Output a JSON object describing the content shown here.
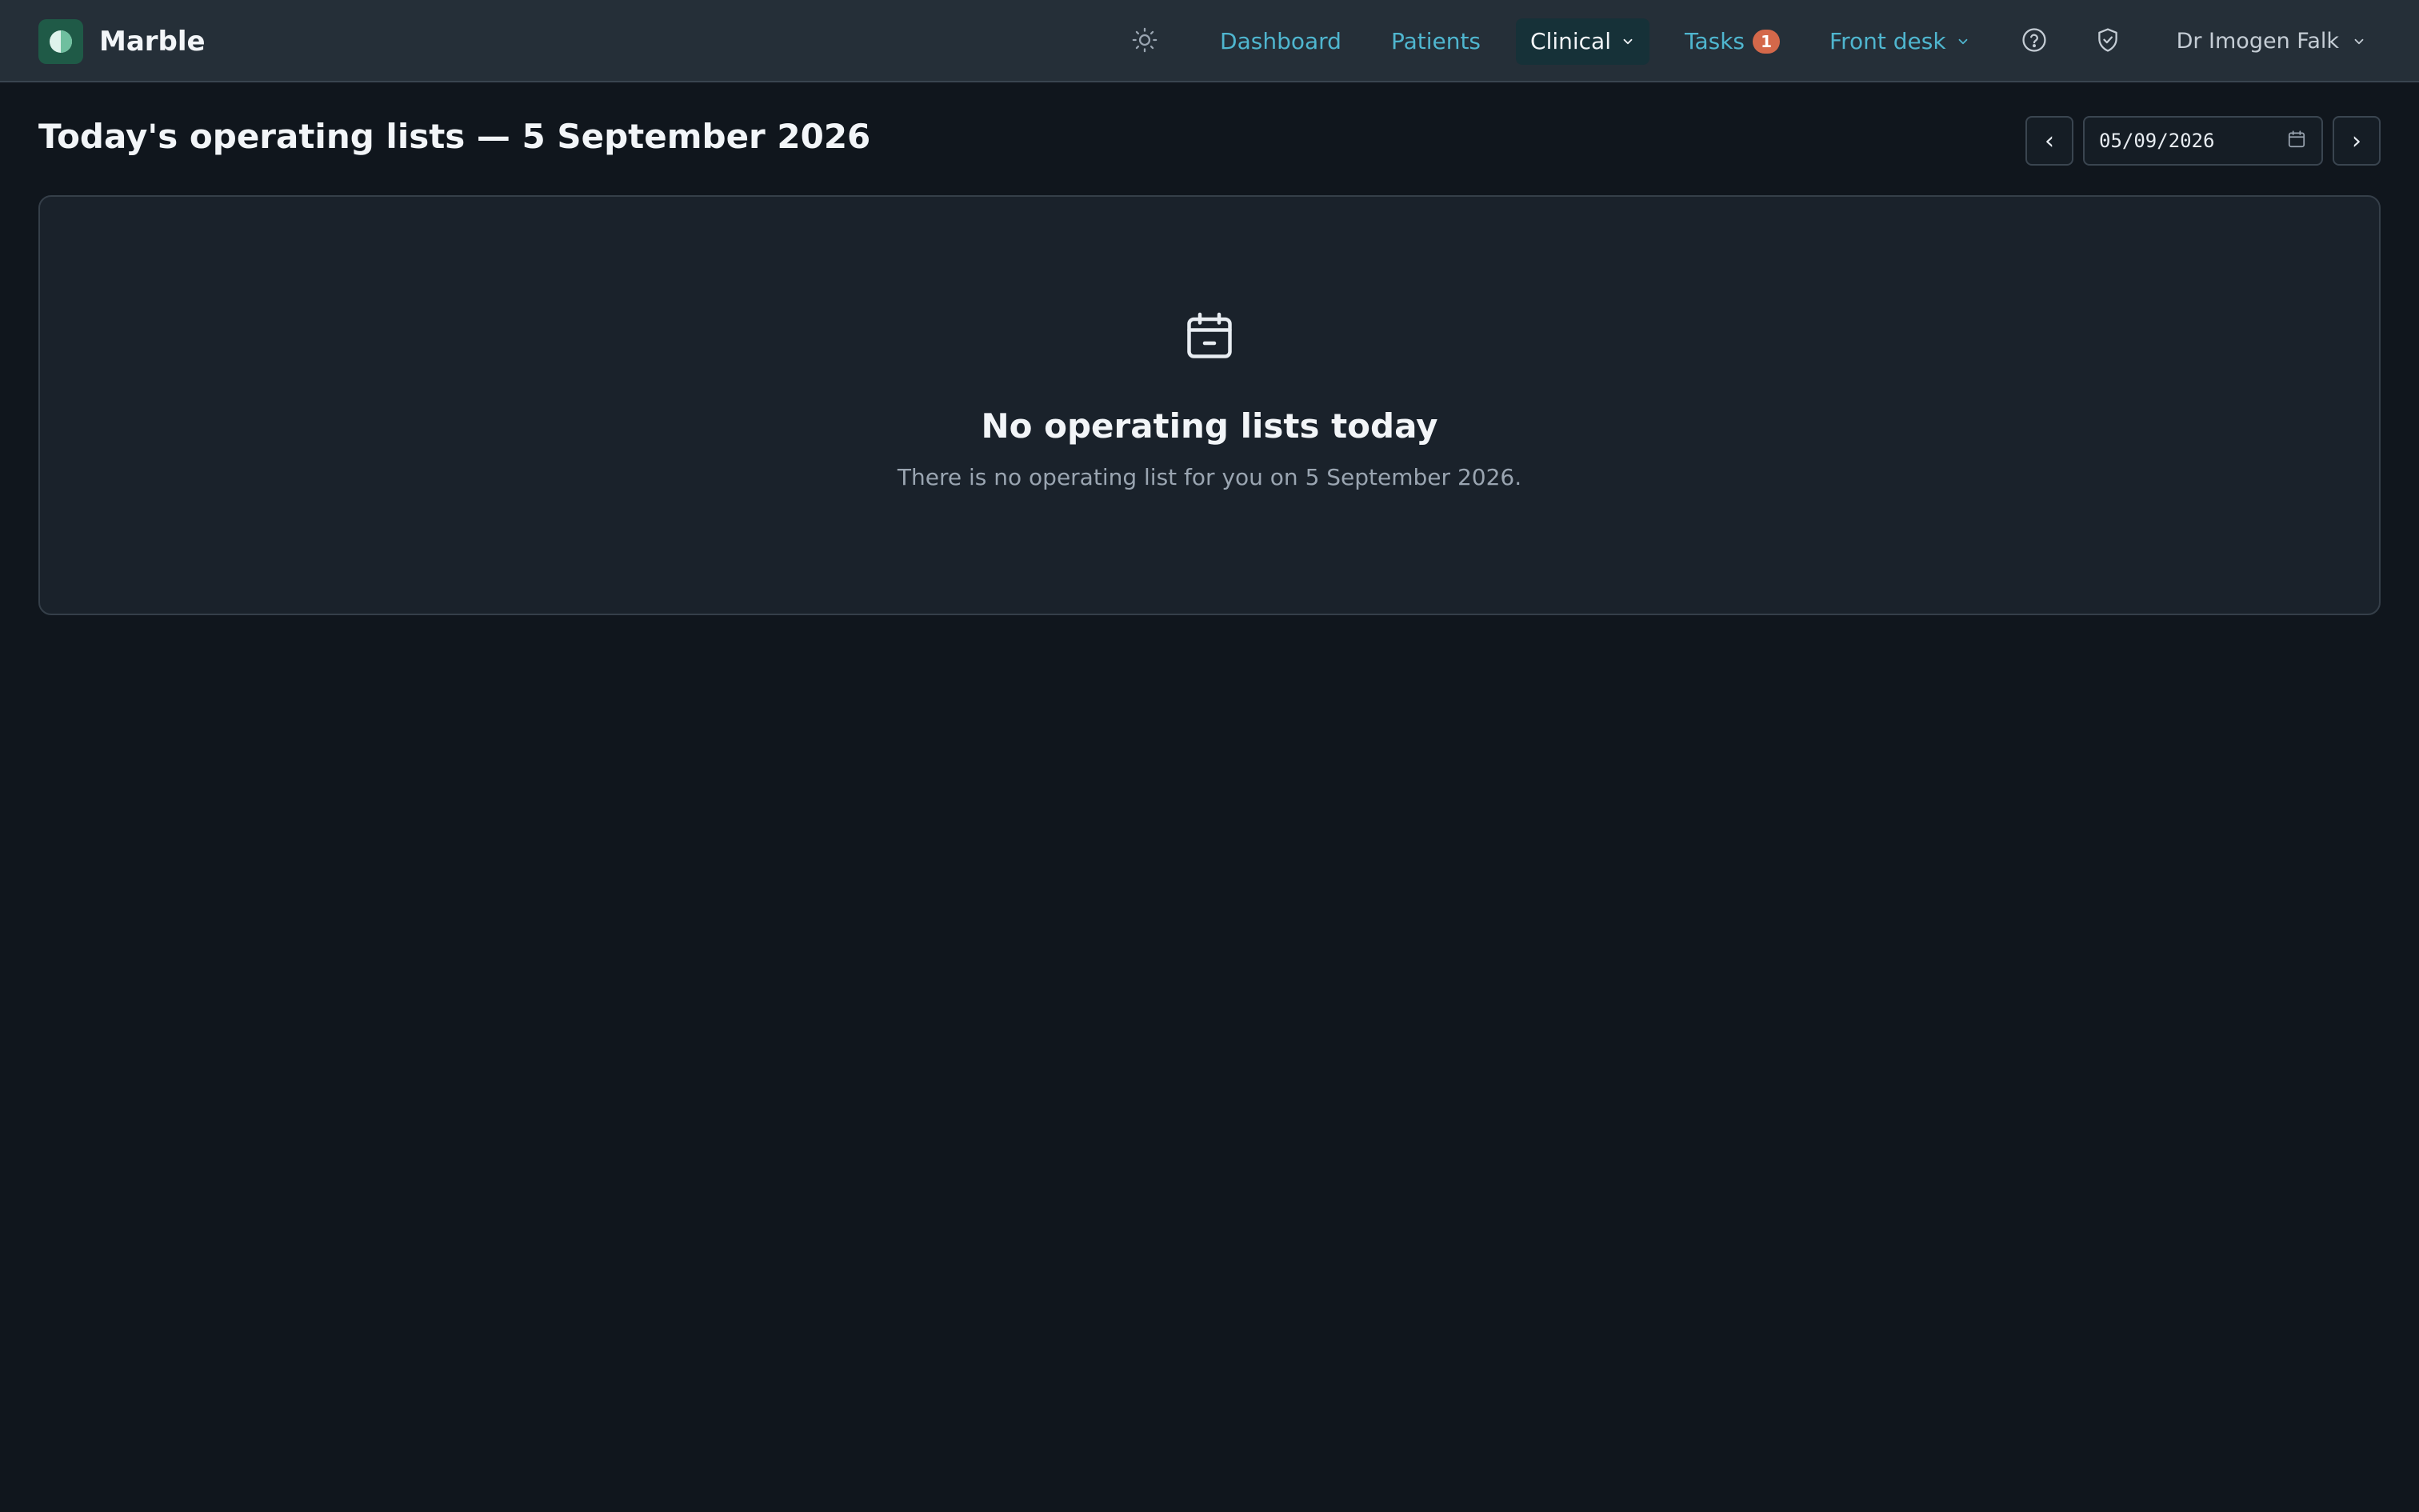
{
  "app": {
    "name": "Marble"
  },
  "nav": {
    "links": [
      {
        "label": "Dashboard"
      },
      {
        "label": "Patients"
      },
      {
        "label": "Clinical"
      },
      {
        "label": "Tasks",
        "badge": "1"
      },
      {
        "label": "Front desk"
      }
    ],
    "active": "Clinical",
    "icons": [
      "sun-icon",
      "help-icon",
      "shield-check-icon"
    ],
    "user": "Dr Imogen Falk"
  },
  "page": {
    "title": "Today's operating lists — 5 September 2026"
  },
  "date_picker": {
    "value": "05/09/2026",
    "prev_label": "‹",
    "next_label": "›"
  },
  "empty_state": {
    "icon": "calendar-minus-icon",
    "title": "No operating lists today",
    "message": "There is no operating list for you on 5 September 2026."
  },
  "colors": {
    "background": "#10161d",
    "navbar": "#252f38",
    "link": "#4fb6cf",
    "active_tab_bg": "#163138",
    "badge": "#d4684a",
    "card": "#1a222b",
    "brand_logo": "#1f5a47"
  }
}
